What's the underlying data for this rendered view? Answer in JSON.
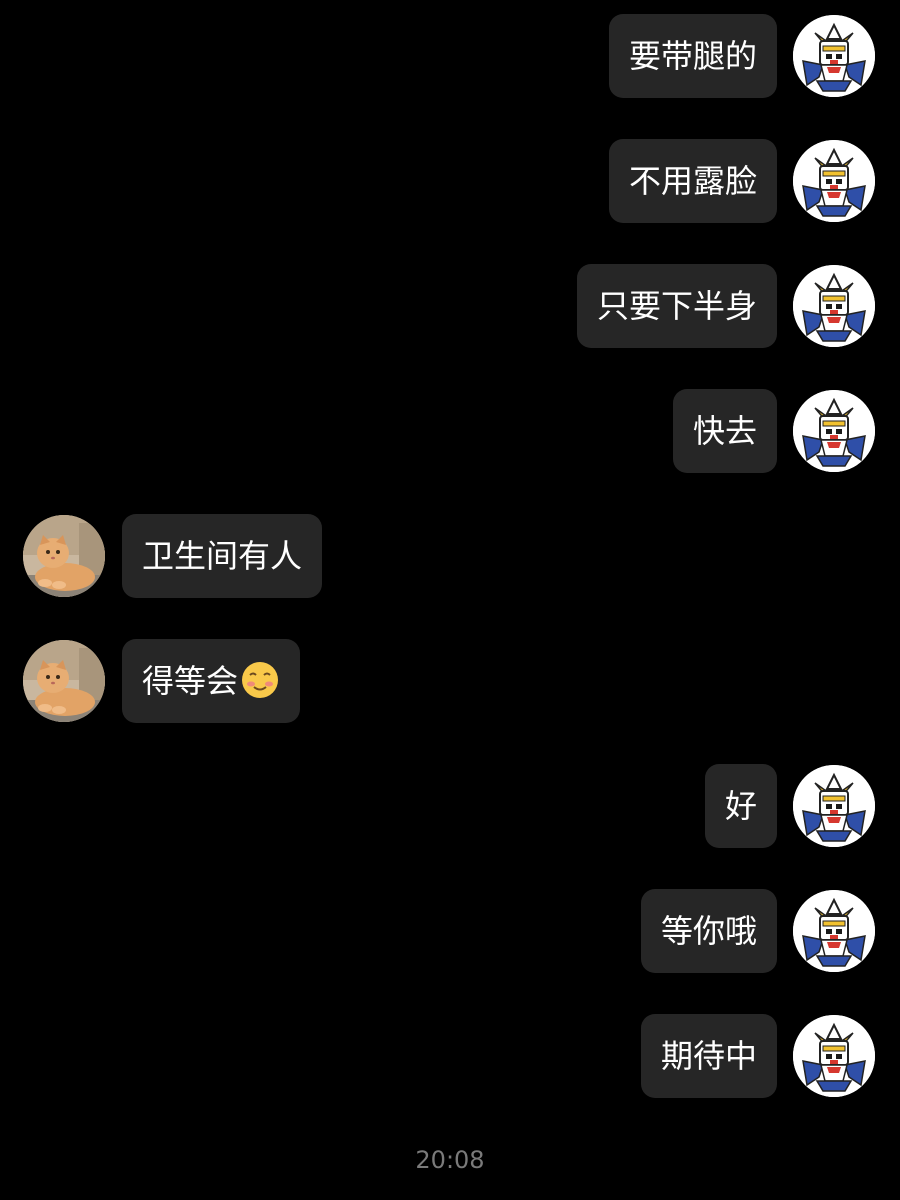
{
  "messages": [
    {
      "side": "me",
      "text": "要带腿的",
      "avatar_icon": "robot-avatar-icon"
    },
    {
      "side": "me",
      "text": "不用露脸",
      "avatar_icon": "robot-avatar-icon"
    },
    {
      "side": "me",
      "text": "只要下半身",
      "avatar_icon": "robot-avatar-icon"
    },
    {
      "side": "me",
      "text": "快去",
      "avatar_icon": "robot-avatar-icon"
    },
    {
      "side": "them",
      "text": "卫生间有人",
      "avatar_icon": "cat-avatar-icon"
    },
    {
      "side": "them",
      "text": "得等会",
      "emoji": "smiling-face-with-blush-icon",
      "avatar_icon": "cat-avatar-icon"
    },
    {
      "side": "me",
      "text": "好",
      "avatar_icon": "robot-avatar-icon"
    },
    {
      "side": "me",
      "text": "等你哦",
      "avatar_icon": "robot-avatar-icon"
    },
    {
      "side": "me",
      "text": "期待中",
      "avatar_icon": "robot-avatar-icon"
    }
  ],
  "timestamp": "20:08",
  "colors": {
    "background": "#000000",
    "bubble": "#262626",
    "text": "#ffffff",
    "timestamp": "#7a7a7a"
  }
}
